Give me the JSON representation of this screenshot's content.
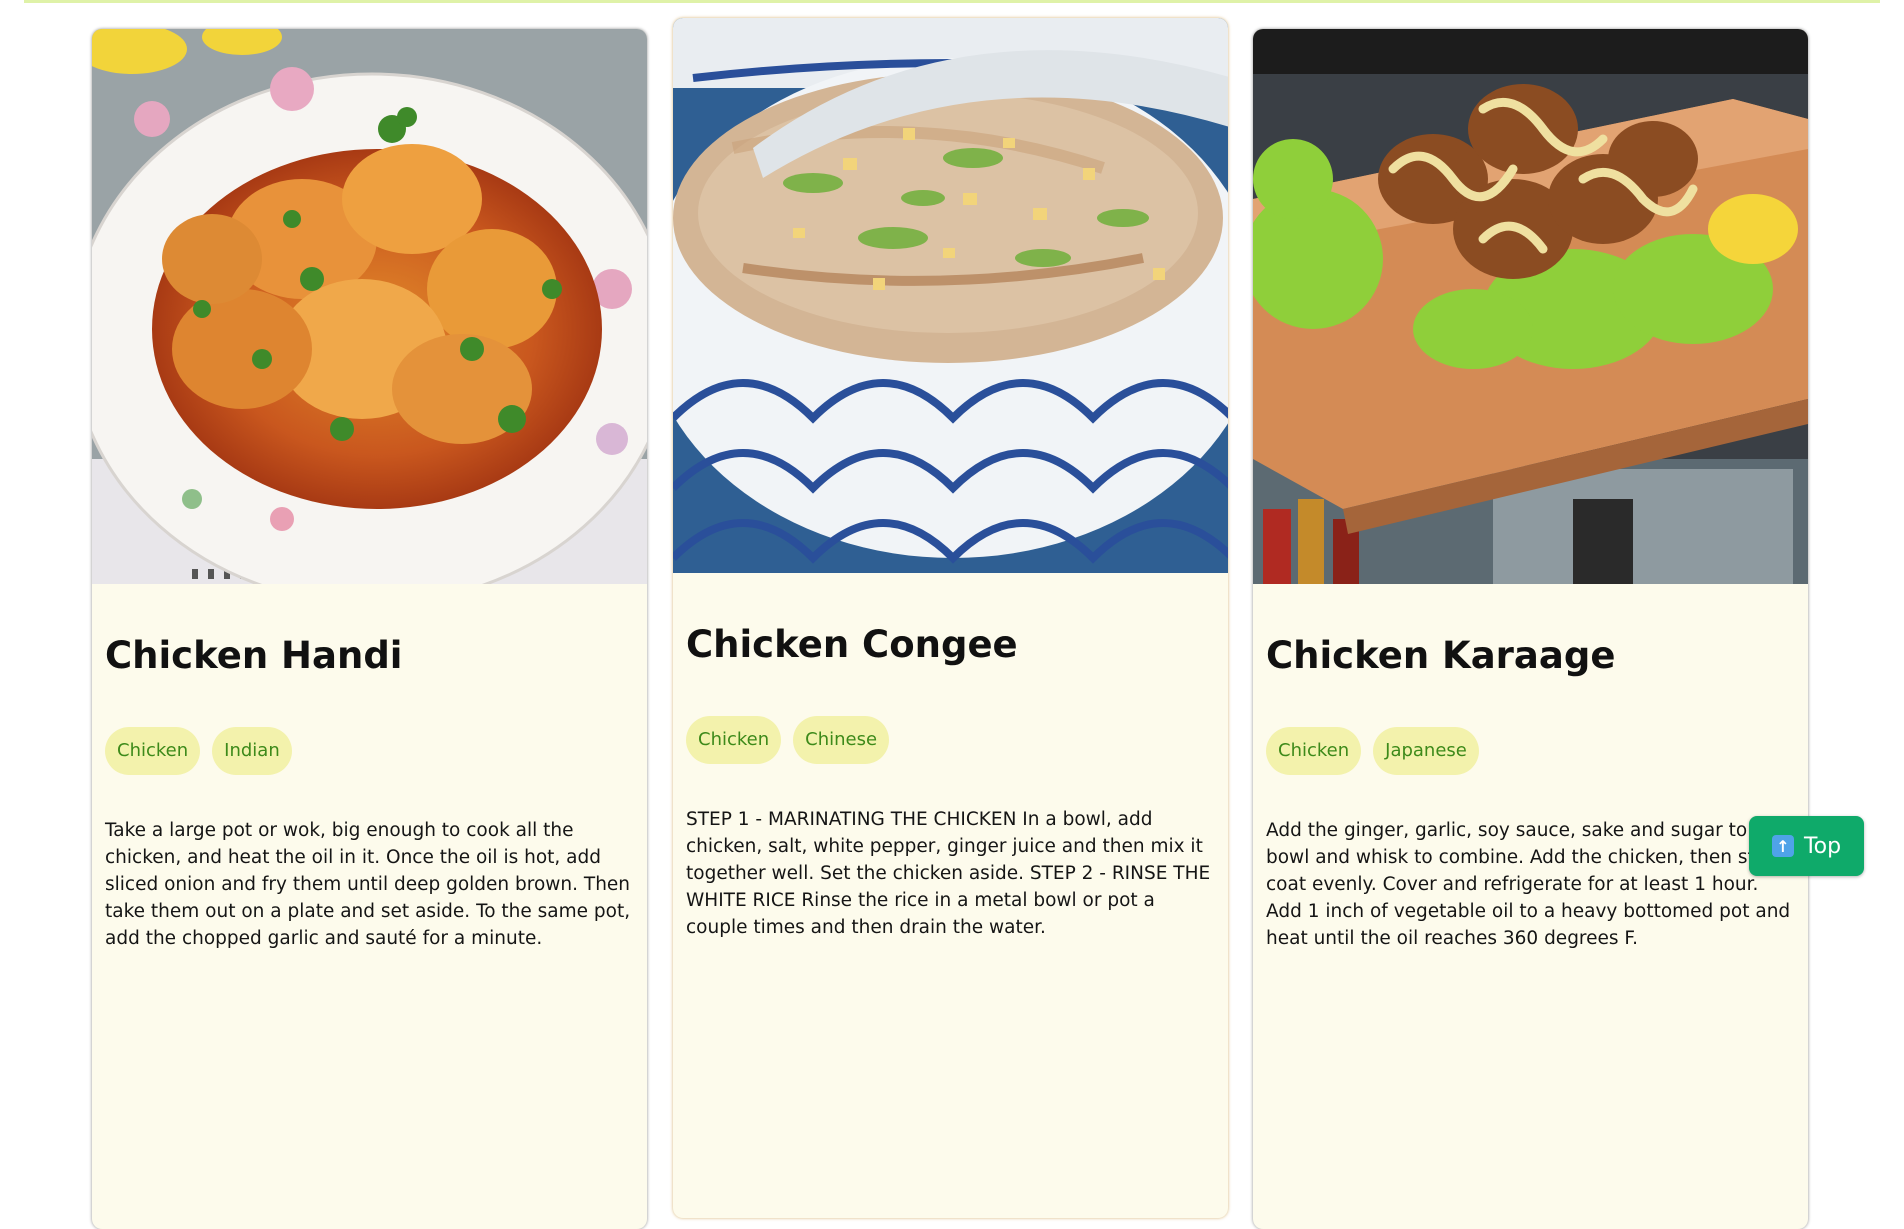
{
  "cards": [
    {
      "title": "Chicken Handi",
      "tags": [
        "Chicken",
        "Indian"
      ],
      "description": "Take a large pot or wok, big enough to cook all the chicken, and heat the oil in it. Once the oil is hot, add sliced onion and fry them until deep golden brown. Then take them out on a plate and set aside. To the same pot, add the chopped garlic and sauté for a minute.",
      "image": "chicken-handi-photo"
    },
    {
      "title": "Chicken Congee",
      "tags": [
        "Chicken",
        "Chinese"
      ],
      "description": "STEP 1 - MARINATING THE CHICKEN In a bowl, add chicken, salt, white pepper, ginger juice and then mix it together well. Set the chicken aside. STEP 2 - RINSE THE WHITE RICE Rinse the rice in a metal bowl or pot a couple times and then drain the water.",
      "image": "chicken-congee-photo"
    },
    {
      "title": "Chicken Karaage",
      "tags": [
        "Chicken",
        "Japanese"
      ],
      "description": "Add the ginger, garlic, soy sauce, sake and sugar to a bowl and whisk to combine. Add the chicken, then stir to coat evenly. Cover and refrigerate for at least 1 hour. Add 1 inch of vegetable oil to a heavy bottomed pot and heat until the oil reaches 360 degrees F.",
      "image": "chicken-karaage-photo"
    }
  ],
  "scroll_top_button": {
    "label": "Top",
    "icon": "up-arrow-icon"
  },
  "colors": {
    "card_bg": "#fdfbec",
    "tag_bg": "#f3f2ac",
    "tag_text": "#3d8a1a",
    "button_bg": "#0faa6a"
  }
}
